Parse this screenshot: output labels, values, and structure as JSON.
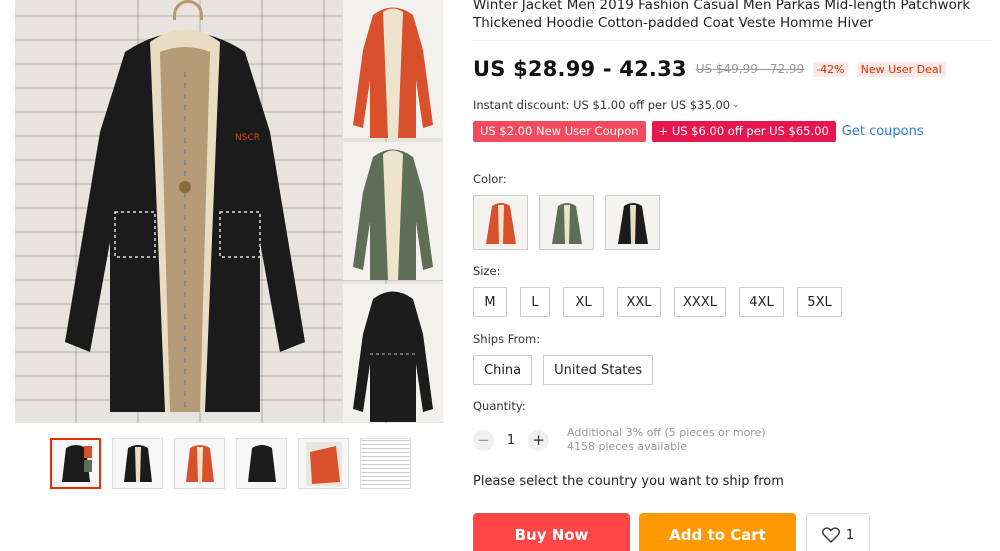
{
  "product": {
    "title": "Winter Jacket Men 2019 Fashion Casual Men Parkas Mid-length Patchwork Thickened Hoodie Cotton-padded Coat Veste Homme Hiver"
  },
  "price": {
    "current": "US $28.99 - 42.33",
    "original": "US $49.99 - 72.99",
    "discount": "-42%",
    "deal_badge": "New User Deal"
  },
  "instant_discount": {
    "text": "Instant discount: US $1.00 off per US $35.00",
    "icon": "chevron-down-icon"
  },
  "coupons": {
    "items": [
      "US $2.00 New User Coupon",
      "+ US $6.00 off per US $65.00"
    ],
    "get_label": "Get coupons",
    "colors": [
      "#f44a5d",
      "#e6164f"
    ]
  },
  "color": {
    "label": "Color:",
    "options": [
      "orange",
      "green",
      "black"
    ],
    "swatches": [
      "#d9512c",
      "#5f6e57",
      "#1c1c1c"
    ]
  },
  "size": {
    "label": "Size:",
    "options": [
      "M",
      "L",
      "XL",
      "XXL",
      "XXXL",
      "4XL",
      "5XL"
    ]
  },
  "ships_from": {
    "label": "Ships From:",
    "options": [
      "China",
      "United States"
    ]
  },
  "quantity": {
    "label": "Quantity:",
    "minus": "−",
    "plus": "+",
    "value": "1",
    "additional": "Additional 3% off (5 pieces or more)",
    "available": "4158 pieces available"
  },
  "ship_message": "Please select the country you want to ship from",
  "actions": {
    "buy_now": "Buy Now",
    "add_to_cart": "Add to Cart",
    "wishlist_count": "1"
  },
  "gallery": {
    "thumbnails": [
      "collage",
      "black-front",
      "orange-front",
      "black-back",
      "orange-detail",
      "size-chart"
    ],
    "active_index": 0
  },
  "accent_colors": {
    "price_red": "#e62e04",
    "buy": "#ff4747",
    "cart": "#ff9900",
    "link": "#2f7ad2"
  }
}
